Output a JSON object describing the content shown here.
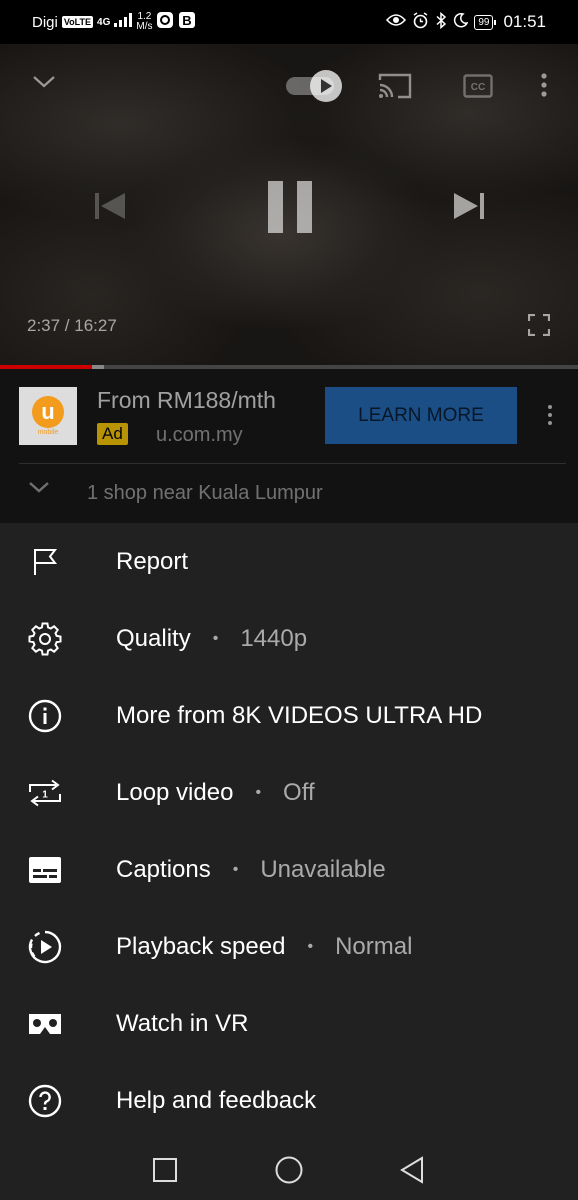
{
  "status_bar": {
    "carrier": "Digi",
    "volte": "VoLTE",
    "network": "4G",
    "speed_value": "1.2",
    "speed_unit": "M/s",
    "battery": "99",
    "time": "01:51"
  },
  "player": {
    "time_display": "2:37 / 16:27",
    "played_fraction": 0.16,
    "buffered_fraction": 0.18
  },
  "ad": {
    "logo_letter": "u",
    "logo_text": "mobile",
    "title": "From RM188/mth",
    "badge": "Ad",
    "domain": "u.com.my",
    "cta": "LEARN MORE",
    "location": "1 shop near Kuala Lumpur"
  },
  "menu": {
    "items": [
      {
        "icon": "flag-icon",
        "label": "Report",
        "value": ""
      },
      {
        "icon": "gear-icon",
        "label": "Quality",
        "value": "1440p"
      },
      {
        "icon": "info-icon",
        "label": "More from 8K VIDEOS ULTRA HD",
        "value": ""
      },
      {
        "icon": "loop-icon",
        "label": "Loop video",
        "value": "Off"
      },
      {
        "icon": "captions-icon",
        "label": "Captions",
        "value": "Unavailable"
      },
      {
        "icon": "playback-speed-icon",
        "label": "Playback speed",
        "value": "Normal"
      },
      {
        "icon": "vr-icon",
        "label": "Watch in VR",
        "value": ""
      },
      {
        "icon": "help-icon",
        "label": "Help and feedback",
        "value": ""
      }
    ]
  },
  "colors": {
    "sheet_bg": "#212121",
    "progress_played": "#cc0000",
    "ad_badge": "#ffcc00",
    "cta_bg": "#1a4e85"
  }
}
